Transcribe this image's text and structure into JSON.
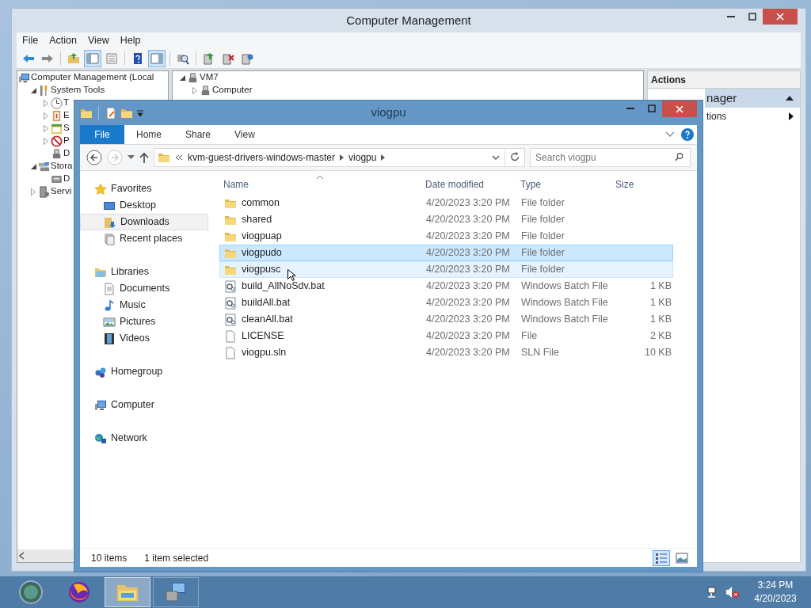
{
  "computer_management": {
    "title": "Computer Management",
    "menu": [
      "File",
      "Action",
      "View",
      "Help"
    ],
    "toolbar": [
      {
        "kind": "back",
        "pressed": false
      },
      {
        "kind": "forward",
        "pressed": false
      },
      {
        "kind": "sep"
      },
      {
        "kind": "up",
        "pressed": false
      },
      {
        "kind": "tree",
        "pressed": true
      },
      {
        "kind": "props",
        "pressed": false
      },
      {
        "kind": "sep"
      },
      {
        "kind": "help",
        "pressed": false
      },
      {
        "kind": "panel",
        "pressed": true
      },
      {
        "kind": "sep"
      },
      {
        "kind": "scan",
        "pressed": false
      },
      {
        "kind": "sep"
      },
      {
        "kind": "export",
        "pressed": false
      },
      {
        "kind": "remove",
        "pressed": false
      },
      {
        "kind": "update",
        "pressed": false
      }
    ],
    "tree": [
      {
        "label": "Computer Management (Local",
        "kind": "computer",
        "children": [
          {
            "label": "System Tools",
            "kind": "tools",
            "expanded": true,
            "children": [
              {
                "label": "T",
                "kind": "clock",
                "expanded": false
              },
              {
                "label": "E",
                "kind": "log",
                "expanded": false
              },
              {
                "label": "S",
                "kind": "calendar",
                "expanded": false
              },
              {
                "label": "P",
                "kind": "nosign",
                "expanded": false
              },
              {
                "label": "D",
                "kind": "device"
              }
            ]
          },
          {
            "label": "Stora",
            "kind": "storage",
            "expanded": true,
            "children": [
              {
                "label": "D",
                "kind": "disk"
              }
            ]
          },
          {
            "label": "Servi",
            "kind": "server",
            "expanded": false
          }
        ]
      }
    ],
    "center": [
      {
        "label": "VM7",
        "kind": "device",
        "expanded": true,
        "children": [
          {
            "label": "Computer",
            "kind": "device",
            "expanded": false
          }
        ]
      }
    ],
    "actions": {
      "header": "Actions",
      "section": "nager",
      "item": "tions"
    }
  },
  "explorer": {
    "title": "viogpu",
    "ribbon_tabs": [
      {
        "label": "File",
        "kind": "menu"
      },
      {
        "label": "Home",
        "kind": "tab"
      },
      {
        "label": "Share",
        "kind": "tab"
      },
      {
        "label": "View",
        "kind": "tab"
      }
    ],
    "address": {
      "path": [
        "kvm-guest-drivers-windows-master",
        "viogpu"
      ]
    },
    "search": {
      "placeholder": "Search viogpu"
    },
    "nav": [
      {
        "label": "Favorites",
        "kind": "star",
        "children": [
          {
            "label": "Desktop",
            "kind": "desktop",
            "hovered": false
          },
          {
            "label": "Downloads",
            "kind": "downloads",
            "hovered": true
          },
          {
            "label": "Recent places",
            "kind": "recent",
            "hovered": false
          }
        ]
      },
      {
        "label": "Libraries",
        "kind": "libraries",
        "children": [
          {
            "label": "Documents",
            "kind": "document",
            "hovered": false
          },
          {
            "label": "Music",
            "kind": "music",
            "hovered": false
          },
          {
            "label": "Pictures",
            "kind": "pictures",
            "hovered": false
          },
          {
            "label": "Videos",
            "kind": "videos",
            "hovered": false
          }
        ]
      },
      {
        "label": "Homegroup",
        "kind": "homegroup"
      },
      {
        "label": "Computer",
        "kind": "computer"
      },
      {
        "label": "Network",
        "kind": "network"
      }
    ],
    "columns": [
      "Name",
      "Date modified",
      "Type",
      "Size"
    ],
    "rows": [
      {
        "name": "common",
        "date": "4/20/2023 3:20 PM",
        "type": "File folder",
        "kind": "folder",
        "selected": false,
        "hovered": false
      },
      {
        "name": "shared",
        "date": "4/20/2023 3:20 PM",
        "type": "File folder",
        "kind": "folder",
        "selected": false,
        "hovered": false
      },
      {
        "name": "viogpuap",
        "date": "4/20/2023 3:20 PM",
        "type": "File folder",
        "kind": "folder",
        "selected": false,
        "hovered": false
      },
      {
        "name": "viogpudo",
        "date": "4/20/2023 3:20 PM",
        "type": "File folder",
        "kind": "folder",
        "selected": true,
        "hovered": false
      },
      {
        "name": "viogpusc",
        "date": "4/20/2023 3:20 PM",
        "type": "File folder",
        "kind": "folder",
        "selected": false,
        "hovered": true
      },
      {
        "name": "build_AllNoSdv.bat",
        "date": "4/20/2023 3:20 PM",
        "type": "Windows Batch File",
        "size": "1 KB",
        "kind": "batch",
        "selected": false,
        "hovered": false
      },
      {
        "name": "buildAll.bat",
        "date": "4/20/2023 3:20 PM",
        "type": "Windows Batch File",
        "size": "1 KB",
        "kind": "batch",
        "selected": false,
        "hovered": false
      },
      {
        "name": "cleanAll.bat",
        "date": "4/20/2023 3:20 PM",
        "type": "Windows Batch File",
        "size": "1 KB",
        "kind": "batch",
        "selected": false,
        "hovered": false
      },
      {
        "name": "LICENSE",
        "date": "4/20/2023 3:20 PM",
        "type": "File",
        "size": "2 KB",
        "kind": "file",
        "selected": false,
        "hovered": false
      },
      {
        "name": "viogpu.sln",
        "date": "4/20/2023 3:20 PM",
        "type": "SLN File",
        "size": "10 KB",
        "kind": "file",
        "selected": false,
        "hovered": false
      }
    ],
    "status": {
      "count": "10 items",
      "selection": "1 item selected"
    },
    "views": [
      {
        "kind": "details",
        "selected": true
      },
      {
        "kind": "large",
        "selected": false
      }
    ]
  },
  "taskbar": {
    "items": [
      {
        "kind": "start",
        "selected": false
      },
      {
        "kind": "firefox",
        "selected": false
      },
      {
        "kind": "explorer",
        "selected": true
      },
      {
        "kind": "compmgmt",
        "selected": false
      }
    ],
    "clock": {
      "time": "3:24 PM",
      "date": "4/20/2023"
    }
  }
}
